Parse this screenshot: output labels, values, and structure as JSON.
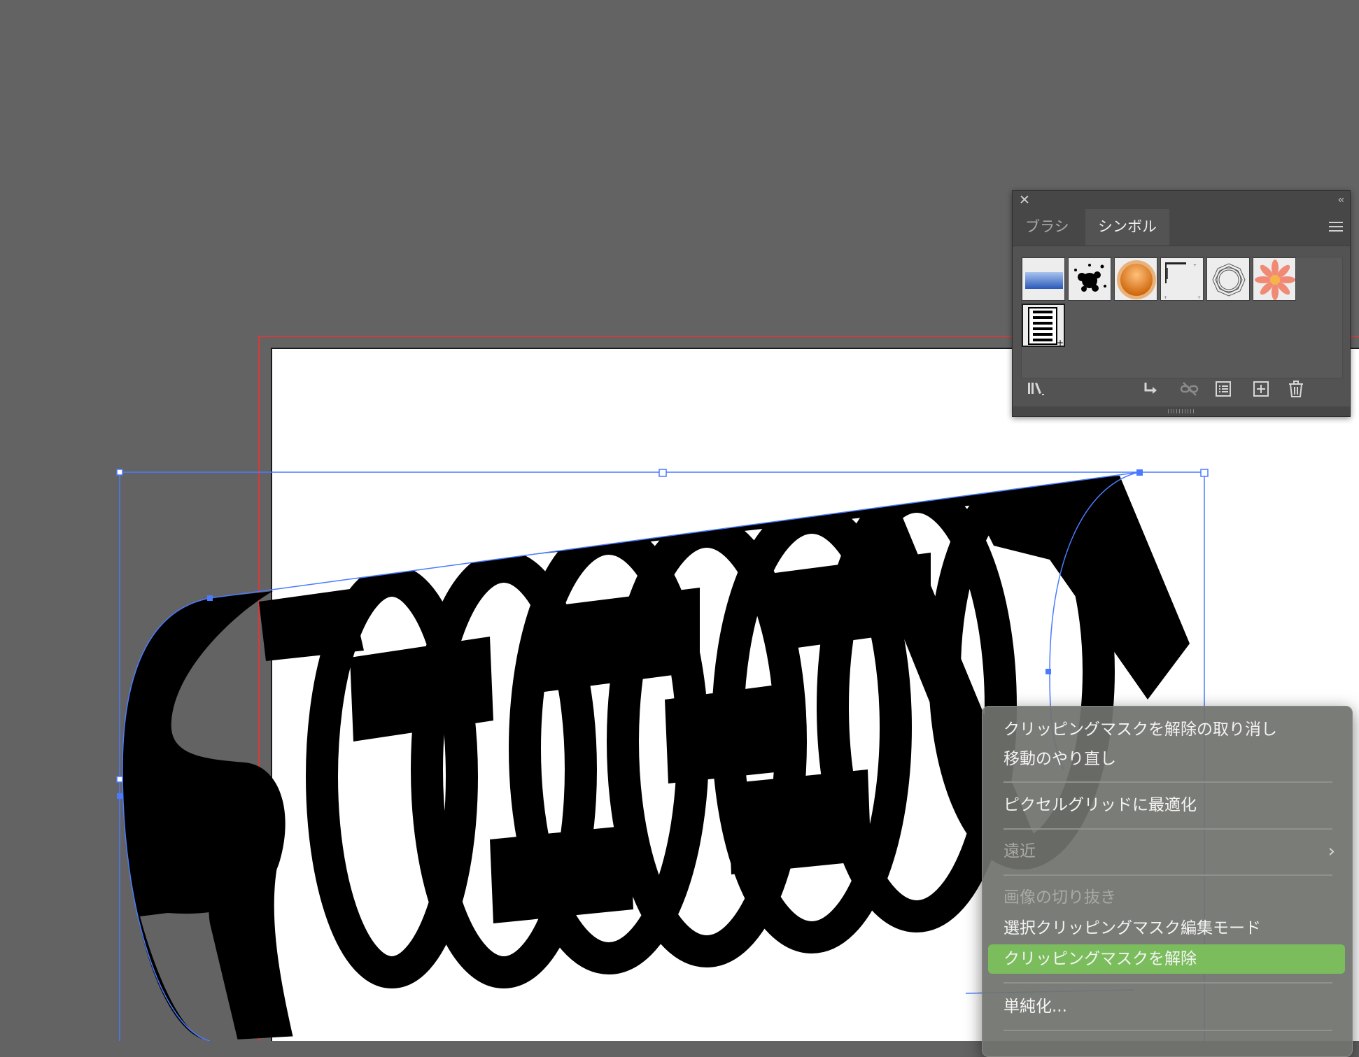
{
  "panel": {
    "tabs": [
      {
        "label": "ブラシ",
        "active": false
      },
      {
        "label": "シンボル",
        "active": true
      }
    ],
    "swatches": [
      "blue-gradient-bar-symbol",
      "ink-splat-symbol",
      "orange-button-symbol",
      "ruler-symbol",
      "wreath-symbol",
      "flower-symbol",
      "custom-text-symbol"
    ],
    "footer_icons": [
      "symbol-libraries-icon",
      "place-symbol-instance-icon",
      "break-link-icon",
      "symbol-options-icon",
      "new-symbol-icon",
      "delete-symbol-icon"
    ]
  },
  "context_menu": {
    "items": [
      {
        "label": "クリッピングマスクを解除の取り消し",
        "disabled": false
      },
      {
        "label": "移動のやり直し",
        "disabled": false
      },
      {
        "label": "ピクセルグリッドに最適化",
        "disabled": false
      },
      {
        "label": "遠近",
        "disabled": true,
        "submenu": true
      },
      {
        "label": "画像の切り抜き",
        "disabled": true
      },
      {
        "label": "選択クリッピングマスク編集モード",
        "disabled": false
      },
      {
        "label": "クリッピングマスクを解除",
        "disabled": false,
        "highlighted": true
      },
      {
        "label": "単純化...",
        "disabled": false
      }
    ]
  },
  "colors": {
    "workspace": "#636363",
    "artboard": "#ffffff",
    "bleed_line": "#d83a3a",
    "selection": "#4a7bff",
    "highlight": "#7bbd5c"
  }
}
